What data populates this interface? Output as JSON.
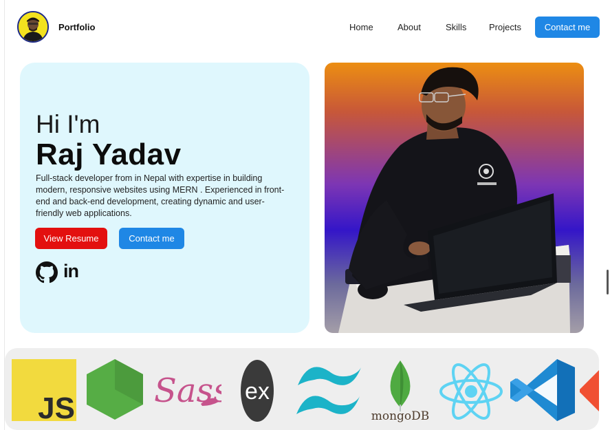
{
  "nav": {
    "brand": "Portfolio",
    "links": [
      "Home",
      "About",
      "Skills",
      "Projects"
    ],
    "cta": "Contact me"
  },
  "hero": {
    "greeting": "Hi I'm",
    "name": "Raj Yadav",
    "bio": "Full-stack developer from in Nepal with expertise in building modern, responsive websites using MERN . Experienced in front-end and back-end development, creating dynamic and user-friendly web applications.",
    "resume_button": "View Resume",
    "contact_button": "Contact me",
    "social": [
      "github-icon",
      "linkedin-icon"
    ],
    "social_linkedin_text": "in"
  },
  "tech_logos": {
    "js": "JS",
    "sass": "Sass",
    "express": "ex",
    "mongo": "mongoDB",
    "items": [
      "javascript-logo",
      "nodejs-logo",
      "sass-logo",
      "express-logo",
      "tailwind-logo",
      "mongodb-logo",
      "react-logo",
      "vscode-logo",
      "git-logo"
    ]
  },
  "colors": {
    "accent": "#1f87e5",
    "resume": "#e3100f",
    "hero_bg": "#dff7fd"
  }
}
